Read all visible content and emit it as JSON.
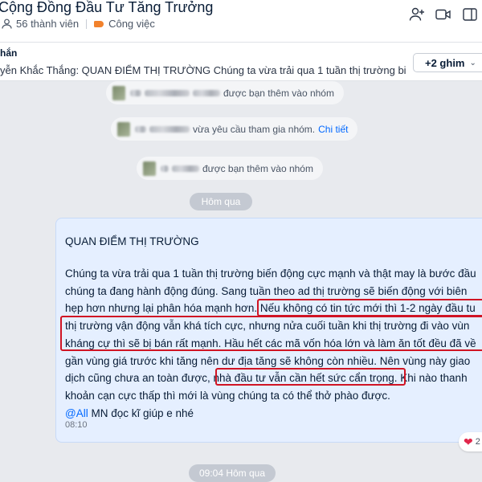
{
  "header": {
    "group_name": "Cộng Đồng Đầu Tư Tăng Trưởng",
    "members": "56 thành viên",
    "tag": "Công việc",
    "icons": [
      "add-member-icon",
      "video-call-icon",
      "sidebar-toggle-icon"
    ]
  },
  "pinned": {
    "title": "hắn",
    "preview": "yễn Khắc Thắng: QUAN ĐIỂM THỊ TRƯỜNG Chúng ta vừa trải qua 1 tuần thị trường biến động...",
    "more_button": "+2 ghim",
    "chevron": "chevron-down-icon"
  },
  "system_messages": [
    {
      "text": "được bạn thêm vào nhóm"
    },
    {
      "text": "vừa yêu cầu tham gia nhóm.",
      "link": "Chi tiết"
    },
    {
      "text": "được bạn thêm vào nhóm"
    }
  ],
  "date_separators": [
    "Hôm qua",
    "09:04 Hôm qua"
  ],
  "message": {
    "title": "QUAN ĐIỂM THỊ TRƯỜNG",
    "lines": [
      "Chúng ta vừa trải qua 1 tuần thị trường biến động cực mạnh và thật may là bước đầu",
      "chúng ta đang hành động đúng. Sang tuần theo ad thị trường sẽ biến động với biên",
      "hẹp hơn nhưng lại phân hóa mạnh hơn. Nếu không có tin tức mới thì 1-2 ngày đầu tu",
      "thị trường vận động vẫn khá tích cực, nhưng nửa cuối tuần khi thị trường đi vào vùn",
      "kháng cự thì sẽ bị bán rất mạnh. Hầu hết các mã vốn hóa lớn và làm ăn tốt đều đã về",
      "gần vùng giá trước khi tăng nên dư địa tăng sẽ không còn nhiều. Nên vùng này giao",
      "dịch cũng chưa an toàn được, nhà đầu tư vẫn cần hết sức cẩn trọng. Khi nào thanh",
      "khoản cạn cực thấp thì mới là vùng chúng ta có thể thở phào được."
    ],
    "mention": "@All",
    "closing": "MN đọc kĩ giúp e nhé",
    "time": "08:10",
    "reaction_count": "2"
  },
  "colors": {
    "accent": "#0068ff",
    "bubble": "#e5efff",
    "highlight": "#d01424",
    "tag": "#f2822c"
  }
}
